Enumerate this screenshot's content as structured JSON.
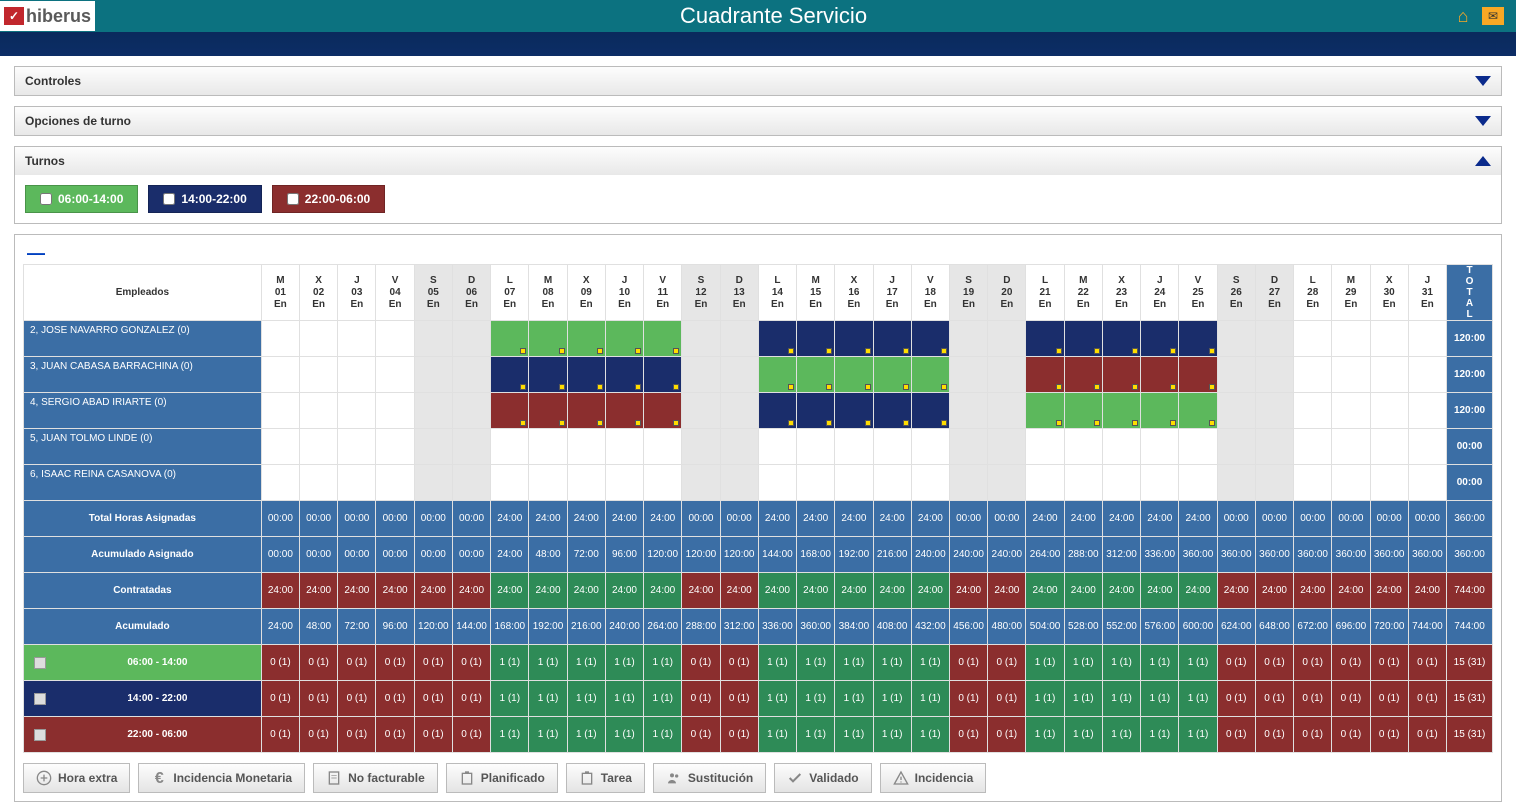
{
  "header": {
    "brand": "hiberus",
    "title": "Cuadrante Servicio"
  },
  "panels": {
    "controles": "Controles",
    "opciones": "Opciones de turno",
    "turnos": "Turnos"
  },
  "shifts": [
    {
      "label": "06:00-14:00",
      "cls": "chip-green"
    },
    {
      "label": "14:00-22:00",
      "cls": "chip-navy"
    },
    {
      "label": "22:00-06:00",
      "cls": "chip-maroon"
    }
  ],
  "cols": {
    "emp": "Empleados",
    "total": "TOTAL"
  },
  "days": [
    {
      "w": "M",
      "d": "01",
      "m": "En",
      "we": false
    },
    {
      "w": "X",
      "d": "02",
      "m": "En",
      "we": false
    },
    {
      "w": "J",
      "d": "03",
      "m": "En",
      "we": false
    },
    {
      "w": "V",
      "d": "04",
      "m": "En",
      "we": false
    },
    {
      "w": "S",
      "d": "05",
      "m": "En",
      "we": true
    },
    {
      "w": "D",
      "d": "06",
      "m": "En",
      "we": true
    },
    {
      "w": "L",
      "d": "07",
      "m": "En",
      "we": false
    },
    {
      "w": "M",
      "d": "08",
      "m": "En",
      "we": false
    },
    {
      "w": "X",
      "d": "09",
      "m": "En",
      "we": false
    },
    {
      "w": "J",
      "d": "10",
      "m": "En",
      "we": false
    },
    {
      "w": "V",
      "d": "11",
      "m": "En",
      "we": false
    },
    {
      "w": "S",
      "d": "12",
      "m": "En",
      "we": true
    },
    {
      "w": "D",
      "d": "13",
      "m": "En",
      "we": true
    },
    {
      "w": "L",
      "d": "14",
      "m": "En",
      "we": false
    },
    {
      "w": "M",
      "d": "15",
      "m": "En",
      "we": false
    },
    {
      "w": "X",
      "d": "16",
      "m": "En",
      "we": false
    },
    {
      "w": "J",
      "d": "17",
      "m": "En",
      "we": false
    },
    {
      "w": "V",
      "d": "18",
      "m": "En",
      "we": false
    },
    {
      "w": "S",
      "d": "19",
      "m": "En",
      "we": true
    },
    {
      "w": "D",
      "d": "20",
      "m": "En",
      "we": true
    },
    {
      "w": "L",
      "d": "21",
      "m": "En",
      "we": false
    },
    {
      "w": "M",
      "d": "22",
      "m": "En",
      "we": false
    },
    {
      "w": "X",
      "d": "23",
      "m": "En",
      "we": false
    },
    {
      "w": "J",
      "d": "24",
      "m": "En",
      "we": false
    },
    {
      "w": "V",
      "d": "25",
      "m": "En",
      "we": false
    },
    {
      "w": "S",
      "d": "26",
      "m": "En",
      "we": true
    },
    {
      "w": "D",
      "d": "27",
      "m": "En",
      "we": true
    },
    {
      "w": "L",
      "d": "28",
      "m": "En",
      "we": false
    },
    {
      "w": "M",
      "d": "29",
      "m": "En",
      "we": false
    },
    {
      "w": "X",
      "d": "30",
      "m": "En",
      "we": false
    },
    {
      "w": "J",
      "d": "31",
      "m": "En",
      "we": false
    }
  ],
  "employees": [
    {
      "name": "2, JOSE NAVARRO GONZALEZ (0)",
      "total": "120:00",
      "shifts": [
        "",
        "",
        "",
        "",
        "",
        "",
        "g",
        "g",
        "g",
        "g",
        "g",
        "",
        "",
        "n",
        "n",
        "n",
        "n",
        "n",
        "",
        "",
        "n",
        "n",
        "n",
        "n",
        "n",
        "",
        "",
        "",
        "",
        "",
        ""
      ]
    },
    {
      "name": "3, JUAN CABASA BARRACHINA (0)",
      "total": "120:00",
      "shifts": [
        "",
        "",
        "",
        "",
        "",
        "",
        "n",
        "n",
        "n",
        "n",
        "n",
        "",
        "",
        "g",
        "g",
        "g",
        "g",
        "g",
        "",
        "",
        "m",
        "m",
        "m",
        "m",
        "m",
        "",
        "",
        "",
        "",
        "",
        ""
      ]
    },
    {
      "name": "4, SERGIO ABAD IRIARTE (0)",
      "total": "120:00",
      "shifts": [
        "",
        "",
        "",
        "",
        "",
        "",
        "m",
        "m",
        "m",
        "m",
        "m",
        "",
        "",
        "n",
        "n",
        "n",
        "n",
        "n",
        "",
        "",
        "g",
        "g",
        "g",
        "g",
        "g",
        "",
        "",
        "",
        "",
        "",
        ""
      ]
    },
    {
      "name": "5, JUAN TOLMO LINDE (0)",
      "total": "00:00",
      "shifts": [
        "",
        "",
        "",
        "",
        "",
        "",
        "",
        "",
        "",
        "",
        "",
        "",
        "",
        "",
        "",
        "",
        "",
        "",
        "",
        "",
        "",
        "",
        "",
        "",
        "",
        "",
        "",
        "",
        "",
        "",
        ""
      ]
    },
    {
      "name": "6, ISAAC REINA CASANOVA (0)",
      "total": "00:00",
      "shifts": [
        "",
        "",
        "",
        "",
        "",
        "",
        "",
        "",
        "",
        "",
        "",
        "",
        "",
        "",
        "",
        "",
        "",
        "",
        "",
        "",
        "",
        "",
        "",
        "",
        "",
        "",
        "",
        "",
        "",
        "",
        ""
      ]
    }
  ],
  "summaryRows": [
    {
      "label": "Total Horas Asignadas",
      "totalCls": "sum-blue",
      "total": "360:00",
      "cells": [
        {
          "v": "00:00",
          "c": "sum-blue"
        },
        {
          "v": "00:00",
          "c": "sum-blue"
        },
        {
          "v": "00:00",
          "c": "sum-blue"
        },
        {
          "v": "00:00",
          "c": "sum-blue"
        },
        {
          "v": "00:00",
          "c": "sum-blue"
        },
        {
          "v": "00:00",
          "c": "sum-blue"
        },
        {
          "v": "24:00",
          "c": "sum-blue"
        },
        {
          "v": "24:00",
          "c": "sum-blue"
        },
        {
          "v": "24:00",
          "c": "sum-blue"
        },
        {
          "v": "24:00",
          "c": "sum-blue"
        },
        {
          "v": "24:00",
          "c": "sum-blue"
        },
        {
          "v": "00:00",
          "c": "sum-blue"
        },
        {
          "v": "00:00",
          "c": "sum-blue"
        },
        {
          "v": "24:00",
          "c": "sum-blue"
        },
        {
          "v": "24:00",
          "c": "sum-blue"
        },
        {
          "v": "24:00",
          "c": "sum-blue"
        },
        {
          "v": "24:00",
          "c": "sum-blue"
        },
        {
          "v": "24:00",
          "c": "sum-blue"
        },
        {
          "v": "00:00",
          "c": "sum-blue"
        },
        {
          "v": "00:00",
          "c": "sum-blue"
        },
        {
          "v": "24:00",
          "c": "sum-blue"
        },
        {
          "v": "24:00",
          "c": "sum-blue"
        },
        {
          "v": "24:00",
          "c": "sum-blue"
        },
        {
          "v": "24:00",
          "c": "sum-blue"
        },
        {
          "v": "24:00",
          "c": "sum-blue"
        },
        {
          "v": "00:00",
          "c": "sum-blue"
        },
        {
          "v": "00:00",
          "c": "sum-blue"
        },
        {
          "v": "00:00",
          "c": "sum-blue"
        },
        {
          "v": "00:00",
          "c": "sum-blue"
        },
        {
          "v": "00:00",
          "c": "sum-blue"
        },
        {
          "v": "00:00",
          "c": "sum-blue"
        }
      ]
    },
    {
      "label": "Acumulado Asignado",
      "totalCls": "sum-blue",
      "total": "360:00",
      "cells": [
        {
          "v": "00:00",
          "c": "sum-blue"
        },
        {
          "v": "00:00",
          "c": "sum-blue"
        },
        {
          "v": "00:00",
          "c": "sum-blue"
        },
        {
          "v": "00:00",
          "c": "sum-blue"
        },
        {
          "v": "00:00",
          "c": "sum-blue"
        },
        {
          "v": "00:00",
          "c": "sum-blue"
        },
        {
          "v": "24:00",
          "c": "sum-blue"
        },
        {
          "v": "48:00",
          "c": "sum-blue"
        },
        {
          "v": "72:00",
          "c": "sum-blue"
        },
        {
          "v": "96:00",
          "c": "sum-blue"
        },
        {
          "v": "120:00",
          "c": "sum-blue"
        },
        {
          "v": "120:00",
          "c": "sum-blue"
        },
        {
          "v": "120:00",
          "c": "sum-blue"
        },
        {
          "v": "144:00",
          "c": "sum-blue"
        },
        {
          "v": "168:00",
          "c": "sum-blue"
        },
        {
          "v": "192:00",
          "c": "sum-blue"
        },
        {
          "v": "216:00",
          "c": "sum-blue"
        },
        {
          "v": "240:00",
          "c": "sum-blue"
        },
        {
          "v": "240:00",
          "c": "sum-blue"
        },
        {
          "v": "240:00",
          "c": "sum-blue"
        },
        {
          "v": "264:00",
          "c": "sum-blue"
        },
        {
          "v": "288:00",
          "c": "sum-blue"
        },
        {
          "v": "312:00",
          "c": "sum-blue"
        },
        {
          "v": "336:00",
          "c": "sum-blue"
        },
        {
          "v": "360:00",
          "c": "sum-blue"
        },
        {
          "v": "360:00",
          "c": "sum-blue"
        },
        {
          "v": "360:00",
          "c": "sum-blue"
        },
        {
          "v": "360:00",
          "c": "sum-blue"
        },
        {
          "v": "360:00",
          "c": "sum-blue"
        },
        {
          "v": "360:00",
          "c": "sum-blue"
        },
        {
          "v": "360:00",
          "c": "sum-blue"
        }
      ]
    },
    {
      "label": "Contratadas",
      "totalCls": "sum-maroon",
      "total": "744:00",
      "cells": [
        {
          "v": "24:00",
          "c": "sum-maroon"
        },
        {
          "v": "24:00",
          "c": "sum-maroon"
        },
        {
          "v": "24:00",
          "c": "sum-maroon"
        },
        {
          "v": "24:00",
          "c": "sum-maroon"
        },
        {
          "v": "24:00",
          "c": "sum-maroon"
        },
        {
          "v": "24:00",
          "c": "sum-maroon"
        },
        {
          "v": "24:00",
          "c": "sum-green"
        },
        {
          "v": "24:00",
          "c": "sum-green"
        },
        {
          "v": "24:00",
          "c": "sum-green"
        },
        {
          "v": "24:00",
          "c": "sum-green"
        },
        {
          "v": "24:00",
          "c": "sum-green"
        },
        {
          "v": "24:00",
          "c": "sum-maroon"
        },
        {
          "v": "24:00",
          "c": "sum-maroon"
        },
        {
          "v": "24:00",
          "c": "sum-green"
        },
        {
          "v": "24:00",
          "c": "sum-green"
        },
        {
          "v": "24:00",
          "c": "sum-green"
        },
        {
          "v": "24:00",
          "c": "sum-green"
        },
        {
          "v": "24:00",
          "c": "sum-green"
        },
        {
          "v": "24:00",
          "c": "sum-maroon"
        },
        {
          "v": "24:00",
          "c": "sum-maroon"
        },
        {
          "v": "24:00",
          "c": "sum-green"
        },
        {
          "v": "24:00",
          "c": "sum-green"
        },
        {
          "v": "24:00",
          "c": "sum-green"
        },
        {
          "v": "24:00",
          "c": "sum-green"
        },
        {
          "v": "24:00",
          "c": "sum-green"
        },
        {
          "v": "24:00",
          "c": "sum-maroon"
        },
        {
          "v": "24:00",
          "c": "sum-maroon"
        },
        {
          "v": "24:00",
          "c": "sum-maroon"
        },
        {
          "v": "24:00",
          "c": "sum-maroon"
        },
        {
          "v": "24:00",
          "c": "sum-maroon"
        },
        {
          "v": "24:00",
          "c": "sum-maroon"
        }
      ]
    },
    {
      "label": "Acumulado",
      "totalCls": "sum-blue",
      "total": "744:00",
      "cells": [
        {
          "v": "24:00",
          "c": "sum-blue"
        },
        {
          "v": "48:00",
          "c": "sum-blue"
        },
        {
          "v": "72:00",
          "c": "sum-blue"
        },
        {
          "v": "96:00",
          "c": "sum-blue"
        },
        {
          "v": "120:00",
          "c": "sum-blue"
        },
        {
          "v": "144:00",
          "c": "sum-blue"
        },
        {
          "v": "168:00",
          "c": "sum-blue"
        },
        {
          "v": "192:00",
          "c": "sum-blue"
        },
        {
          "v": "216:00",
          "c": "sum-blue"
        },
        {
          "v": "240:00",
          "c": "sum-blue"
        },
        {
          "v": "264:00",
          "c": "sum-blue"
        },
        {
          "v": "288:00",
          "c": "sum-blue"
        },
        {
          "v": "312:00",
          "c": "sum-blue"
        },
        {
          "v": "336:00",
          "c": "sum-blue"
        },
        {
          "v": "360:00",
          "c": "sum-blue"
        },
        {
          "v": "384:00",
          "c": "sum-blue"
        },
        {
          "v": "408:00",
          "c": "sum-blue"
        },
        {
          "v": "432:00",
          "c": "sum-blue"
        },
        {
          "v": "456:00",
          "c": "sum-blue"
        },
        {
          "v": "480:00",
          "c": "sum-blue"
        },
        {
          "v": "504:00",
          "c": "sum-blue"
        },
        {
          "v": "528:00",
          "c": "sum-blue"
        },
        {
          "v": "552:00",
          "c": "sum-blue"
        },
        {
          "v": "576:00",
          "c": "sum-blue"
        },
        {
          "v": "600:00",
          "c": "sum-blue"
        },
        {
          "v": "624:00",
          "c": "sum-blue"
        },
        {
          "v": "648:00",
          "c": "sum-blue"
        },
        {
          "v": "672:00",
          "c": "sum-blue"
        },
        {
          "v": "696:00",
          "c": "sum-blue"
        },
        {
          "v": "720:00",
          "c": "sum-blue"
        },
        {
          "v": "744:00",
          "c": "sum-blue"
        }
      ]
    }
  ],
  "shiftCountRows": [
    {
      "label": "06:00 - 14:00",
      "cls": "srg",
      "total": "15 (31)"
    },
    {
      "label": "14:00 - 22:00",
      "cls": "srn",
      "total": "15 (31)"
    },
    {
      "label": "22:00 - 06:00",
      "cls": "srm",
      "total": "15 (31)"
    }
  ],
  "shiftCountPattern": {
    "zero": "0 (1)",
    "one": "1 (1)",
    "workdays": [
      6,
      7,
      8,
      9,
      10,
      13,
      14,
      15,
      16,
      17,
      20,
      21,
      22,
      23,
      24
    ]
  },
  "actions": [
    {
      "label": "Hora extra",
      "icon": "plus"
    },
    {
      "label": "Incidencia Monetaria",
      "icon": "euro"
    },
    {
      "label": "No facturable",
      "icon": "doc"
    },
    {
      "label": "Planificado",
      "icon": "clip"
    },
    {
      "label": "Tarea",
      "icon": "clip"
    },
    {
      "label": "Sustitución",
      "icon": "people"
    },
    {
      "label": "Validado",
      "icon": "check"
    },
    {
      "label": "Incidencia",
      "icon": "warn"
    }
  ]
}
